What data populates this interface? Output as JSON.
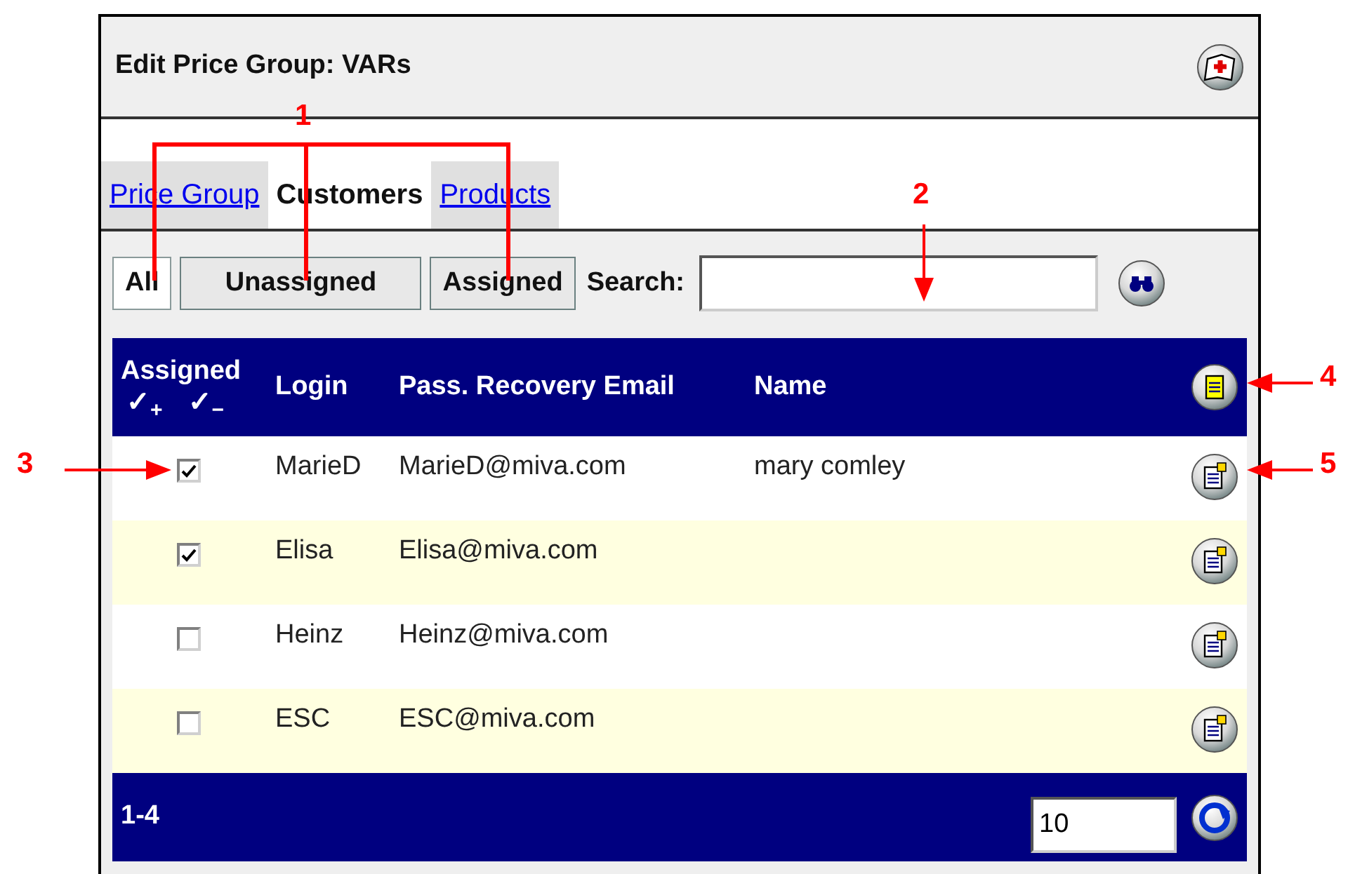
{
  "window": {
    "title": "Edit Price Group: VARs"
  },
  "tabs": [
    {
      "label": "Price Group",
      "selected": false
    },
    {
      "label": "Customers",
      "selected": true
    },
    {
      "label": "Products",
      "selected": false
    }
  ],
  "filters": [
    {
      "label": "All",
      "selected": true
    },
    {
      "label": "Unassigned",
      "selected": false
    },
    {
      "label": "Assigned",
      "selected": false
    }
  ],
  "search": {
    "label": "Search:"
  },
  "table": {
    "columns": [
      "Assigned",
      "Login",
      "Pass. Recovery Email",
      "Name"
    ],
    "assign_marks": [
      "✓$_{+}$",
      "✓$_{−}$"
    ],
    "rows": [
      {
        "assigned": true,
        "login": "MarieD",
        "email": "MarieD@miva.com",
        "name": "mary comley"
      },
      {
        "assigned": true,
        "login": "Elisa",
        "email": "Elisa@miva.com"
      },
      {
        "assigned": false,
        "login": "Heinz",
        "email": "Heinz@miva.com"
      },
      {
        "assigned": false,
        "login": "ESC",
        "email": "ESC@miva.com"
      }
    ]
  },
  "footer": {
    "range": "1-4",
    "page_size": "10"
  },
  "annotations": [
    {
      "label": "1"
    },
    {
      "label": "2"
    },
    {
      "label": "3"
    },
    {
      "label": "4"
    },
    {
      "label": "5"
    }
  ]
}
